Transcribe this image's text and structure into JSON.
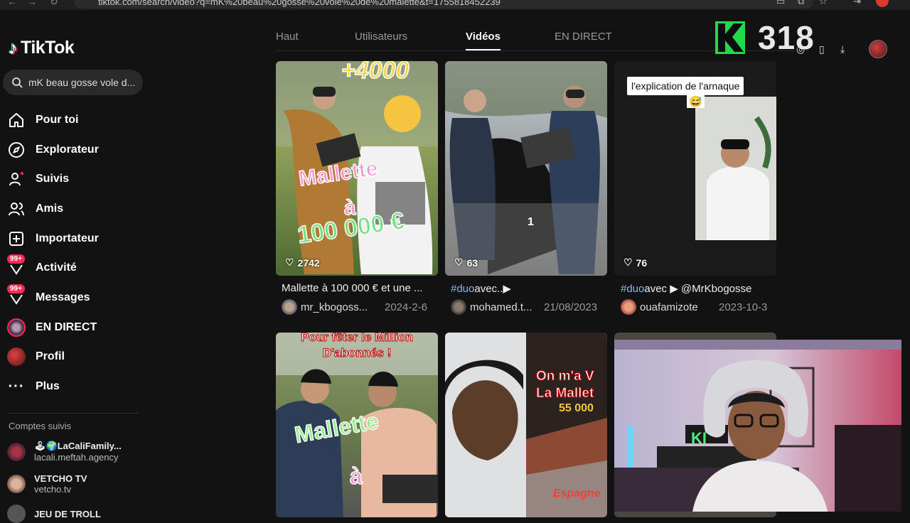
{
  "browser": {
    "url": "tiktok.com/search/video?q=mK%20beau%20gosse%20vole%20de%20malette&t=1755818452239"
  },
  "app": {
    "name": "TikTok"
  },
  "search": {
    "query": "mK beau gosse vole d..."
  },
  "menu": [
    {
      "label": "Pour toi",
      "icon": "home-icon"
    },
    {
      "label": "Explorateur",
      "icon": "compass-icon"
    },
    {
      "label": "Suivis",
      "icon": "following-icon"
    },
    {
      "label": "Amis",
      "icon": "friends-icon"
    },
    {
      "label": "Importateur",
      "icon": "upload-icon"
    },
    {
      "label": "Activité",
      "icon": "inbox-icon",
      "badge": "99+"
    },
    {
      "label": "Messages",
      "icon": "messages-icon",
      "badge": "99+"
    },
    {
      "label": "EN DIRECT",
      "icon": "live-icon"
    },
    {
      "label": "Profil",
      "icon": "profile-avatar"
    },
    {
      "label": "Plus",
      "icon": "more-icon"
    }
  ],
  "followed": {
    "title": "Comptes suivis",
    "accounts": [
      {
        "name": "🕹🌍LaCaliFamily...",
        "handle": "lacali.meftah.agency"
      },
      {
        "name": "VETCHO TV",
        "handle": "vetcho.tv"
      },
      {
        "name": "JEU DE TROLL",
        "handle": ""
      }
    ]
  },
  "tabs": [
    {
      "label": "Haut",
      "active": false
    },
    {
      "label": "Utilisateurs",
      "active": false
    },
    {
      "label": "Vidéos",
      "active": true
    },
    {
      "label": "EN DIRECT",
      "active": false
    }
  ],
  "videos": [
    {
      "likes": "2742",
      "overlay": [
        "+4000",
        "Mallette",
        "à",
        "100 000 €"
      ],
      "caption": "Mallette à 100 000 € et une ...",
      "author": "mr_kbogoss...",
      "date": "2024-2-6"
    },
    {
      "likes": "63",
      "overlay_number": "1",
      "caption_tag": "#duo",
      "caption": "avec..▶",
      "author": "mohamed.t...",
      "date": "21/08/2023"
    },
    {
      "likes": "76",
      "overlay_title": "l'explication  de l'arnaque",
      "overlay_emoji": "😅",
      "caption_tag": "#duo",
      "caption": "avec ▶ @MrKbogosse",
      "author": "ouafamizote",
      "date": "2023-10-3"
    },
    {
      "overlay": [
        "Pour fêter le Million",
        "D'abonnés !",
        "Mallette",
        "à"
      ]
    },
    {
      "overlay": [
        "On m'a V",
        "La Mallet",
        "55 000",
        "Espagne"
      ]
    },
    {}
  ],
  "stream": {
    "k_label": "K",
    "count": "318"
  },
  "colors": {
    "background": "#121212",
    "accent": "#fe2c55",
    "stream_green": "#22d94a"
  }
}
